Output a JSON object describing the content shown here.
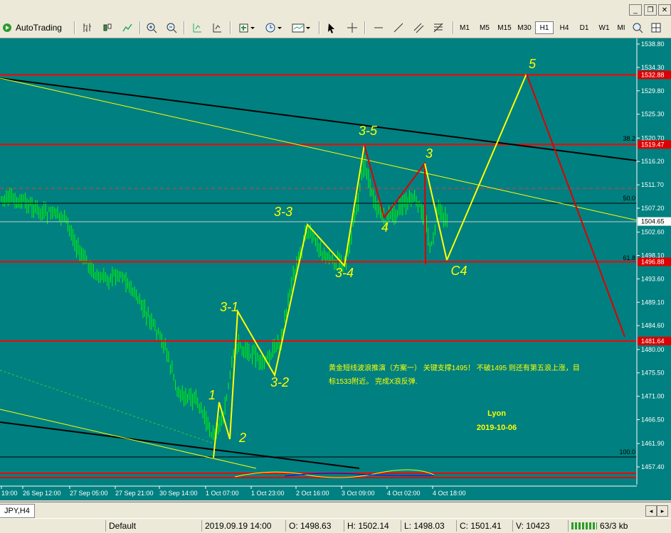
{
  "toolbar": {
    "autotrading_label": "AutoTrading",
    "timeframes": [
      "M1",
      "M5",
      "M15",
      "M30",
      "H1",
      "H4",
      "D1",
      "W1",
      "MI"
    ],
    "active_timeframe": "H1",
    "icons": [
      "autotrading-icon",
      "bar-chart-icon",
      "candlestick-icon",
      "line-chart-icon",
      "zoom-in-icon",
      "zoom-out-icon",
      "tile-icon",
      "scroll-icon",
      "indicator-add-icon",
      "clock-icon",
      "template-icon",
      "cursor-icon",
      "crosshair-icon",
      "hline-icon",
      "trendline-icon",
      "equidistant-icon",
      "fibo-icon"
    ]
  },
  "window": {
    "restore_label": "❐",
    "close_label": "✕"
  },
  "chart_data": {
    "type": "candlestick",
    "symbol_tab": "JPY,H4",
    "price_axis": {
      "ticks": [
        "1538.80",
        "1534.30",
        "1529.80",
        "1525.30",
        "1520.70",
        "1516.20",
        "1511.70",
        "1507.20",
        "1502.60",
        "1498.10",
        "1493.60",
        "1489.10",
        "1484.60",
        "1480.00",
        "1475.50",
        "1471.00",
        "1466.50",
        "1461.90",
        "1457.40"
      ],
      "labels": [
        {
          "text": "1532.88",
          "bg": "#dd0000"
        },
        {
          "text": "1519.47",
          "bg": "#dd0000"
        },
        {
          "text": "1504.65",
          "bg": "#ffffff"
        },
        {
          "text": "1496.88",
          "bg": "#dd0000"
        },
        {
          "text": "1481.64",
          "bg": "#dd0000"
        }
      ]
    },
    "time_axis": [
      "19:00",
      "26 Sep 12:00",
      "27 Sep 05:00",
      "27 Sep 21:00",
      "30 Sep 14:00",
      "1 Oct 07:00",
      "1 Oct 23:00",
      "2 Oct 16:00",
      "3 Oct 09:00",
      "4 Oct 02:00",
      "4 Oct 18:00"
    ],
    "fib_levels": [
      "38.2",
      "50.0",
      "61.8",
      "100.0"
    ],
    "wave_labels": [
      "5",
      "3-5",
      "3",
      "3-3",
      "4",
      "3-4",
      "C4",
      "3-1",
      "3-2",
      "1",
      "2"
    ],
    "annotation": {
      "line1": "黄金短线波浪推演（方案一）  关键支撑1495！   不破1495 则还有第五浪上涨，目",
      "line2": "标1533附近。 完成X浪反弹.",
      "author": "Lyon",
      "date": "2019-10-06"
    },
    "colors": {
      "background": "#008080",
      "candles": "#00ff00",
      "support": "#ff0000",
      "projection_up": "#ffff00",
      "projection_down": "#ff0000",
      "channel": "#000000"
    }
  },
  "status": {
    "profile": "Default",
    "time": "2019.09.19 14:00",
    "open": "O: 1498.63",
    "high": "H: 1502.14",
    "low": "L: 1498.03",
    "close": "C: 1501.41",
    "volume": "V: 10423",
    "traffic": "63/3 kb"
  }
}
